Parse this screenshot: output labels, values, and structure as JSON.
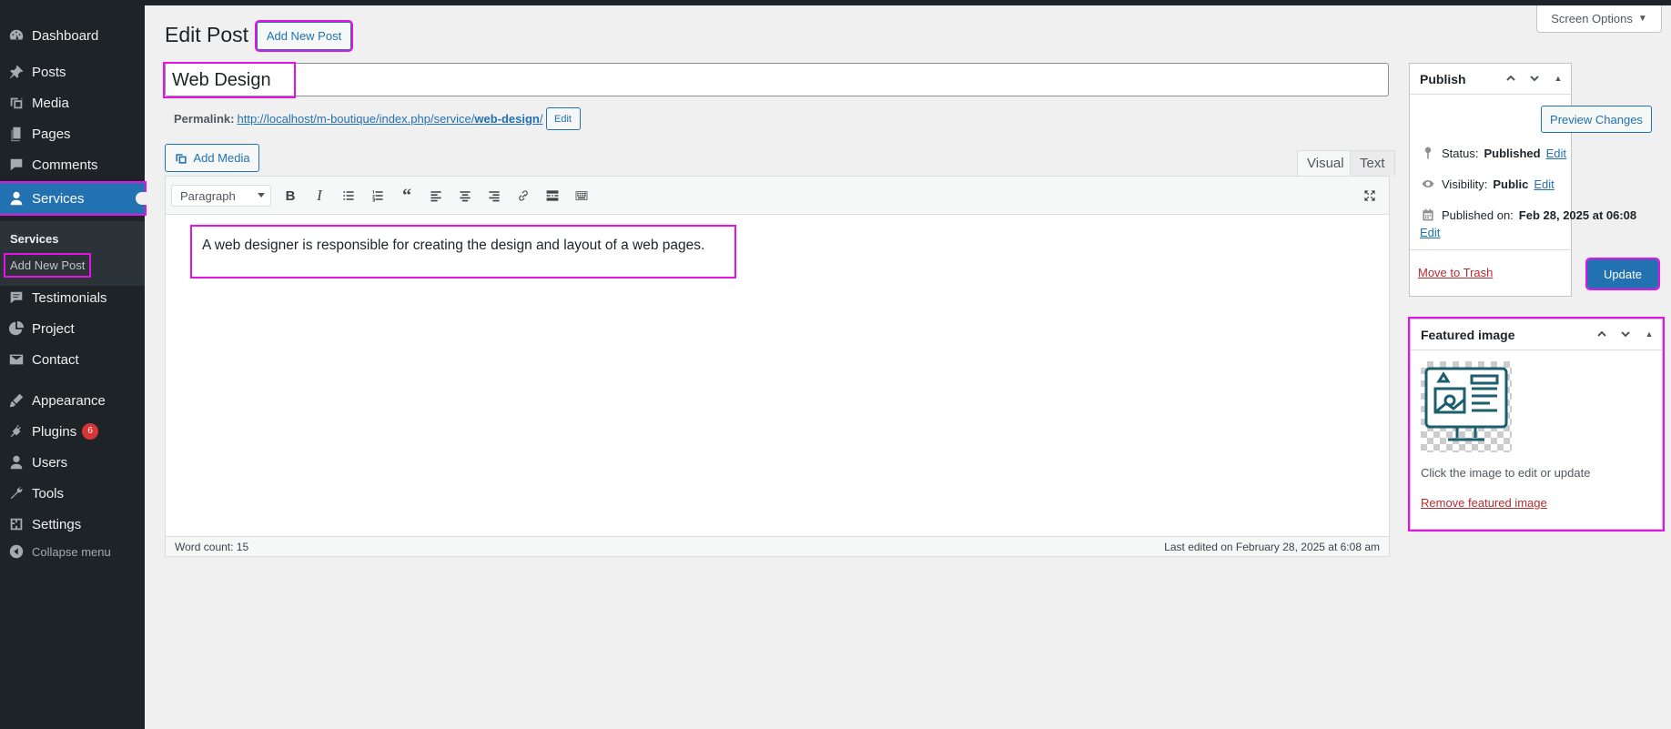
{
  "sidebar": {
    "items": [
      {
        "label": "Dashboard",
        "icon": "dashboard-icon"
      },
      {
        "label": "Posts",
        "icon": "pin-icon"
      },
      {
        "label": "Media",
        "icon": "media-icon"
      },
      {
        "label": "Pages",
        "icon": "pages-icon"
      },
      {
        "label": "Comments",
        "icon": "comments-icon"
      },
      {
        "label": "Services",
        "icon": "user-icon"
      },
      {
        "label": "Testimonials",
        "icon": "testimonials-icon"
      },
      {
        "label": "Project",
        "icon": "pie-chart-icon"
      },
      {
        "label": "Contact",
        "icon": "envelope-icon"
      },
      {
        "label": "Appearance",
        "icon": "brush-icon"
      },
      {
        "label": "Plugins",
        "icon": "plugin-icon",
        "badge": "6"
      },
      {
        "label": "Users",
        "icon": "users-icon"
      },
      {
        "label": "Tools",
        "icon": "wrench-icon"
      },
      {
        "label": "Settings",
        "icon": "settings-icon"
      }
    ],
    "submenu": {
      "heading": "Services",
      "add_new": "Add New Post"
    },
    "collapse": "Collapse menu"
  },
  "header": {
    "screen_options": "Screen Options",
    "title": "Edit Post",
    "add_new": "Add New Post"
  },
  "post": {
    "title": "Web Design",
    "permalink_label": "Permalink:",
    "permalink_base": "http://localhost/m-boutique/index.php/service/",
    "permalink_slug": "web-design",
    "permalink_end": "/",
    "permalink_edit": "Edit"
  },
  "editor": {
    "add_media": "Add Media",
    "tab_visual": "Visual",
    "tab_text": "Text",
    "format_select": "Paragraph",
    "content": "A web designer is responsible for creating the design and layout of a web pages.",
    "word_count": "Word count: 15",
    "last_edited": "Last edited on February 28, 2025 at 6:08 am"
  },
  "publish": {
    "title": "Publish",
    "preview": "Preview Changes",
    "status_label": "Status:",
    "status_value": "Published",
    "visibility_label": "Visibility:",
    "visibility_value": "Public",
    "published_label": "Published on:",
    "published_value": "Feb 28, 2025 at 06:08",
    "edit": "Edit",
    "trash": "Move to Trash",
    "update": "Update"
  },
  "featured": {
    "title": "Featured image",
    "help": "Click the image to edit or update",
    "remove": "Remove featured image"
  },
  "colors": {
    "accent": "#2271b1",
    "sidebar": "#1d2327",
    "highlight": "#e512e5"
  }
}
